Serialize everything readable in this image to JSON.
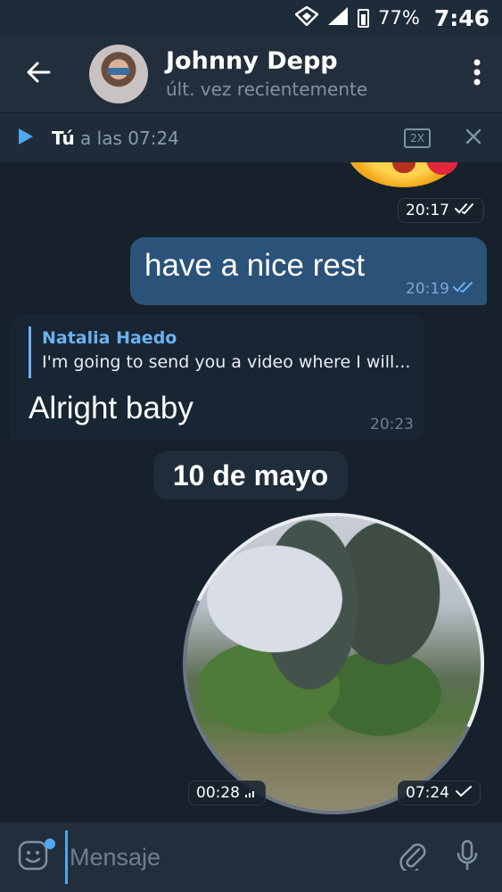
{
  "status_bar": {
    "battery": "77%",
    "time": "7:46"
  },
  "header": {
    "contact_name": "Johnny Depp",
    "last_seen": "últ. vez recientemente"
  },
  "player": {
    "user": "Tú",
    "time_text": "a las 07:24",
    "speed": "2X"
  },
  "messages": {
    "sticker_time": "20:17",
    "outgoing": {
      "text": "have a nice rest",
      "time": "20:19"
    },
    "incoming": {
      "reply_name": "Natalia Haedo",
      "reply_text": "I'm going to send you a video where I will...",
      "text": "Alright baby",
      "time": "20:23"
    },
    "date_separator": "10 de mayo",
    "video": {
      "duration": "00:28",
      "time": "07:24"
    }
  },
  "composer": {
    "placeholder": "Mensaje"
  },
  "colors": {
    "background": "#17212b",
    "header": "#232e3c",
    "outgoing_bubble": "#2b5278",
    "incoming_bubble": "#182533",
    "accent": "#6ab2f2"
  }
}
